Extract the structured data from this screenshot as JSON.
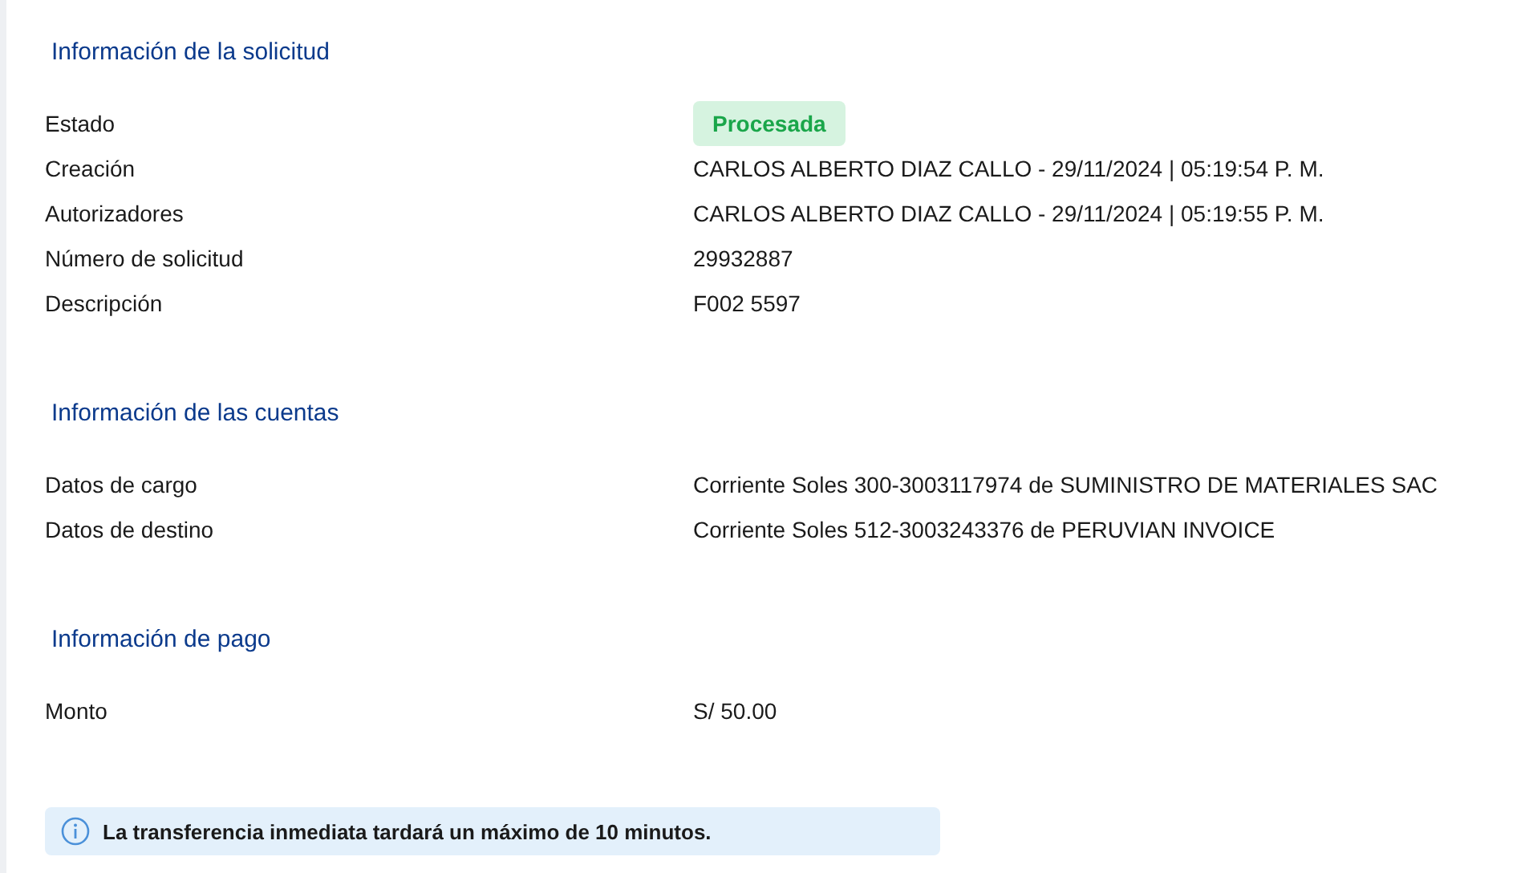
{
  "sections": [
    {
      "title": "Información de la solicitud",
      "rows": [
        {
          "label": "Estado",
          "kind": "badge",
          "value": "Procesada"
        },
        {
          "label": "Creación",
          "kind": "text",
          "value": "CARLOS ALBERTO DIAZ CALLO - 29/11/2024 | 05:19:54 P. M."
        },
        {
          "label": "Autorizadores",
          "kind": "text",
          "value": "CARLOS ALBERTO DIAZ CALLO - 29/11/2024 | 05:19:55 P. M."
        },
        {
          "label": "Número de solicitud",
          "kind": "text",
          "value": "29932887"
        },
        {
          "label": "Descripción",
          "kind": "text",
          "value": "F002 5597"
        }
      ]
    },
    {
      "title": "Información de las cuentas",
      "rows": [
        {
          "label": "Datos de cargo",
          "kind": "text",
          "value": "Corriente Soles 300-3003117974 de SUMINISTRO DE MATERIALES SAC"
        },
        {
          "label": "Datos de destino",
          "kind": "text",
          "value": "Corriente Soles 512-3003243376 de PERUVIAN INVOICE"
        }
      ]
    },
    {
      "title": "Información de pago",
      "rows": [
        {
          "label": "Monto",
          "kind": "text",
          "value": "S/ 50.00"
        }
      ]
    }
  ],
  "notice": {
    "text": "La transferencia inmediata tardará un máximo de 10 minutos."
  }
}
